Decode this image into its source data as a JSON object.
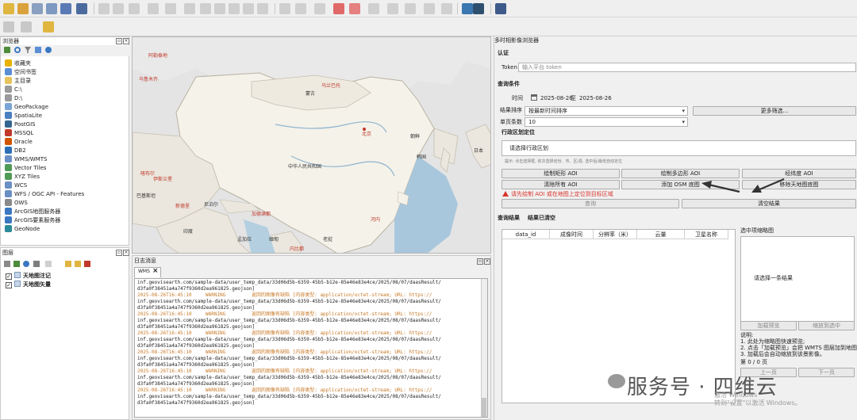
{
  "browser": {
    "title": "浏览器",
    "items": [
      {
        "label": "收藏夹",
        "icon": "star-icon",
        "color": "#e8b200"
      },
      {
        "label": "空间书签",
        "icon": "bookmark-icon",
        "color": "#5a8fd6"
      },
      {
        "label": "主目录",
        "icon": "folder-icon",
        "color": "#e6c35c"
      },
      {
        "label": "C:\\",
        "icon": "drive-icon",
        "color": "#9a9a9a"
      },
      {
        "label": "D:\\",
        "icon": "drive-icon",
        "color": "#9a9a9a"
      },
      {
        "label": "GeoPackage",
        "icon": "geopackage-icon",
        "color": "#7aa5d6"
      },
      {
        "label": "SpatiaLite",
        "icon": "spatialite-icon",
        "color": "#4a7fc1"
      },
      {
        "label": "PostGIS",
        "icon": "postgis-icon",
        "color": "#336791"
      },
      {
        "label": "MSSQL",
        "icon": "mssql-icon",
        "color": "#c0392b"
      },
      {
        "label": "Oracle",
        "icon": "oracle-icon",
        "color": "#d35400"
      },
      {
        "label": "DB2",
        "icon": "db2-icon",
        "color": "#2c6fb7"
      },
      {
        "label": "WMS/WMTS",
        "icon": "wms-icon",
        "color": "#6b8fc4"
      },
      {
        "label": "Vector Tiles",
        "icon": "vector-tiles-icon",
        "color": "#4f9a56"
      },
      {
        "label": "XYZ Tiles",
        "icon": "xyz-tiles-icon",
        "color": "#4f9a56"
      },
      {
        "label": "WCS",
        "icon": "wcs-icon",
        "color": "#6b8fc4"
      },
      {
        "label": "WFS / OGC API - Features",
        "icon": "wfs-icon",
        "color": "#6b8fc4"
      },
      {
        "label": "OWS",
        "icon": "ows-icon",
        "color": "#8a8a8a"
      },
      {
        "label": "ArcGIS地图服务器",
        "icon": "arcgis-icon",
        "color": "#3a78c2"
      },
      {
        "label": "ArcGIS要素服务器",
        "icon": "arcgis-icon",
        "color": "#3a78c2"
      },
      {
        "label": "GeoNode",
        "icon": "geonode-icon",
        "color": "#2d8a9a"
      }
    ]
  },
  "layers": {
    "title": "图层",
    "items": [
      {
        "label": "天地图注记",
        "checked": "✓"
      },
      {
        "label": "天地图矢量",
        "checked": "✓"
      }
    ]
  },
  "map": {
    "labels": [
      {
        "text": "阿勒泰地",
        "color": "red"
      },
      {
        "text": "乌鲁木齐",
        "color": "red"
      },
      {
        "text": "乌兰巴托",
        "color": "red"
      },
      {
        "text": "蒙古",
        "color": "dark"
      },
      {
        "text": "北京",
        "color": "red"
      },
      {
        "text": "中华人民共和国",
        "color": "dark"
      },
      {
        "text": "朝鲜",
        "color": "dark"
      },
      {
        "text": "韩国",
        "color": "dark"
      },
      {
        "text": "日本",
        "color": "dark"
      },
      {
        "text": "印度",
        "color": "dark"
      },
      {
        "text": "尼泊尔",
        "color": "dark"
      },
      {
        "text": "缅甸",
        "color": "dark"
      },
      {
        "text": "巴基斯坦",
        "color": "dark"
      },
      {
        "text": "新德里",
        "color": "red"
      },
      {
        "text": "喀布尔",
        "color": "red"
      },
      {
        "text": "伊斯兰堡",
        "color": "red"
      },
      {
        "text": "加德满都",
        "color": "red"
      },
      {
        "text": "孟加拉",
        "color": "dark"
      },
      {
        "text": "内比都",
        "color": "red"
      },
      {
        "text": "河内",
        "color": "red"
      },
      {
        "text": "老挝",
        "color": "dark"
      }
    ]
  },
  "log": {
    "title": "日志消息",
    "tab": "WMS",
    "url_prefix": "inf.geovisearth.com/sample-data/user_temp_data/33d06d5b-6359-45b5-b12e-85e46e83e4ce/2025/08/07/daasResult/",
    "file": "d3fa0f38451a4a747f9360d2ea961825.geojson]",
    "time": "2025-08-26T16:45:10",
    "level": "WARNING",
    "msg": "返回的图像有缺陷 [内容类型: application/octet-stream; URL: https://"
  },
  "plugin": {
    "title": "多时相影像浏览器",
    "auth_header": "认证",
    "token_label": "Token",
    "token_placeholder": "输入平台 token",
    "query_header": "查询条件",
    "time_label": "时间",
    "date_from": "2025-08-26",
    "date_to_sep": "至",
    "date_to": "2025-08-26",
    "sort_label": "结果排序",
    "sort_value": "按最新时间排序",
    "more_filters": "更多筛选...",
    "page_size_label": "单页条数",
    "page_size_value": "10",
    "admin_header": "行政区划定位",
    "admin_placeholder": "请选择行政区划",
    "admin_hint": "提示: 点击选择框, 依次选择省份、市、区/县, 选中后/最低自动定位",
    "btn_draw_rect": "绘制矩形 AOI",
    "btn_draw_polygon": "绘制多边形 AOI",
    "btn_latlon": "经纬度 AOI",
    "btn_clear_aoi": "清除所有 AOI",
    "btn_add_osm": "添加 OSM 底图",
    "btn_remove_tdt": "移除天地图底图",
    "warning": "请先绘制 AOI 或在地图上定位到目标区域",
    "btn_query": "查询",
    "btn_clear_results": "清空结果",
    "results_header": "查询结果",
    "results_cleared": "结果已清空",
    "columns": [
      "data_id",
      "成像时间",
      "分辨率（米）",
      "云量",
      "卫星名称"
    ],
    "preview_title": "选中项缩略图",
    "preview_placeholder": "请选择一条结果",
    "btn_load_preview": "加载预览",
    "btn_zoom_selected": "缩放到选中",
    "instructions_title": "说明:",
    "instructions": [
      "1. 此处为缩略图快速预览;",
      "2. 点击「加载预览」会把 WMTS 图层加到地图;",
      "3. 加载后会自动缩放到该景影像。"
    ],
    "page_info": "第 0 / 0 页",
    "btn_prev": "上一页",
    "btn_next": "下一页"
  },
  "watermark": {
    "text": "服务号 · 四维云",
    "activate_line1": "激活 Windows",
    "activate_line2": "转到\"设置\"以激活 Windows。"
  }
}
